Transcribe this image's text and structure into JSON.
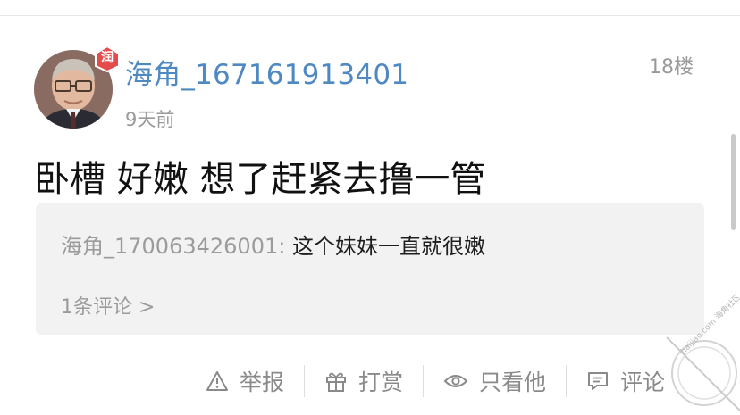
{
  "post": {
    "username": "海角_167161913401",
    "badge": "润",
    "time": "9天前",
    "floor": "18楼",
    "content": "卧槽 好嫩 想了赶紧去撸一管"
  },
  "reply": {
    "user": "海角_170063426001: ",
    "text": "这个妹妹一直就很嫩",
    "count": "1条评论 >"
  },
  "actions": [
    {
      "label": "举报",
      "icon": "warning-icon"
    },
    {
      "label": "打赏",
      "icon": "gift-icon"
    },
    {
      "label": "只看他",
      "icon": "eye-icon"
    },
    {
      "label": "评论",
      "icon": "comment-icon"
    }
  ],
  "watermark": {
    "text": "haijiao.com 海角社区"
  }
}
